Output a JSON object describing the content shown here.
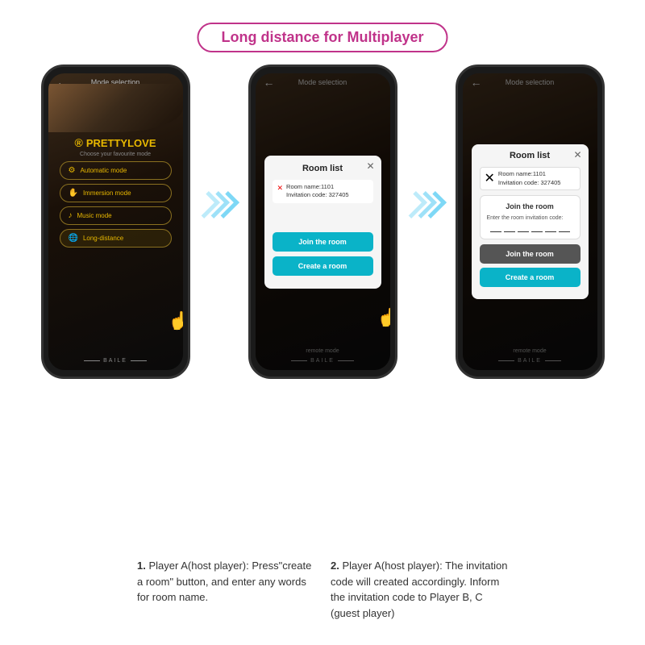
{
  "title": {
    "text": "Long distance for Multiplayer"
  },
  "phone1": {
    "topbar": "Mode selection",
    "logo": "PRETTYLOVE",
    "subtitle": "Choose your favourite mode",
    "modes": [
      {
        "label": "Automatic mode",
        "icon": "⚙"
      },
      {
        "label": "Immersion mode",
        "icon": "✋"
      },
      {
        "label": "Music mode",
        "icon": "♪"
      },
      {
        "label": "Long-distance",
        "icon": "🌐"
      }
    ],
    "footer": "BAILE"
  },
  "phone2": {
    "topbar": "Mode selection",
    "modal": {
      "title": "Room list",
      "room_name_label": "Room name:1101",
      "invitation_label": "Invitation code: 327405",
      "join_btn": "Join the room",
      "create_btn": "Create a room"
    },
    "footer": "BAILE",
    "remote_mode": "remote mode"
  },
  "phone3": {
    "topbar": "Mode selection",
    "modal": {
      "title": "Room list",
      "room_name_label": "Room name:1101",
      "invitation_label": "Invitation code: 327405",
      "join_section_title": "Join the room",
      "join_label": "Enter the room invitation code:",
      "join_btn": "Join the room",
      "create_btn": "Create a room"
    },
    "footer": "BAILE",
    "remote_mode": "remote mode"
  },
  "instructions": [
    {
      "number": "1.",
      "text": "Player A(host player): Press\"create a room\" button, and enter any words for room name."
    },
    {
      "number": "2.",
      "text": "Player A(host player): The invitation code will created accordingly. Inform the invitation code to Player B, C (guest player)"
    }
  ]
}
